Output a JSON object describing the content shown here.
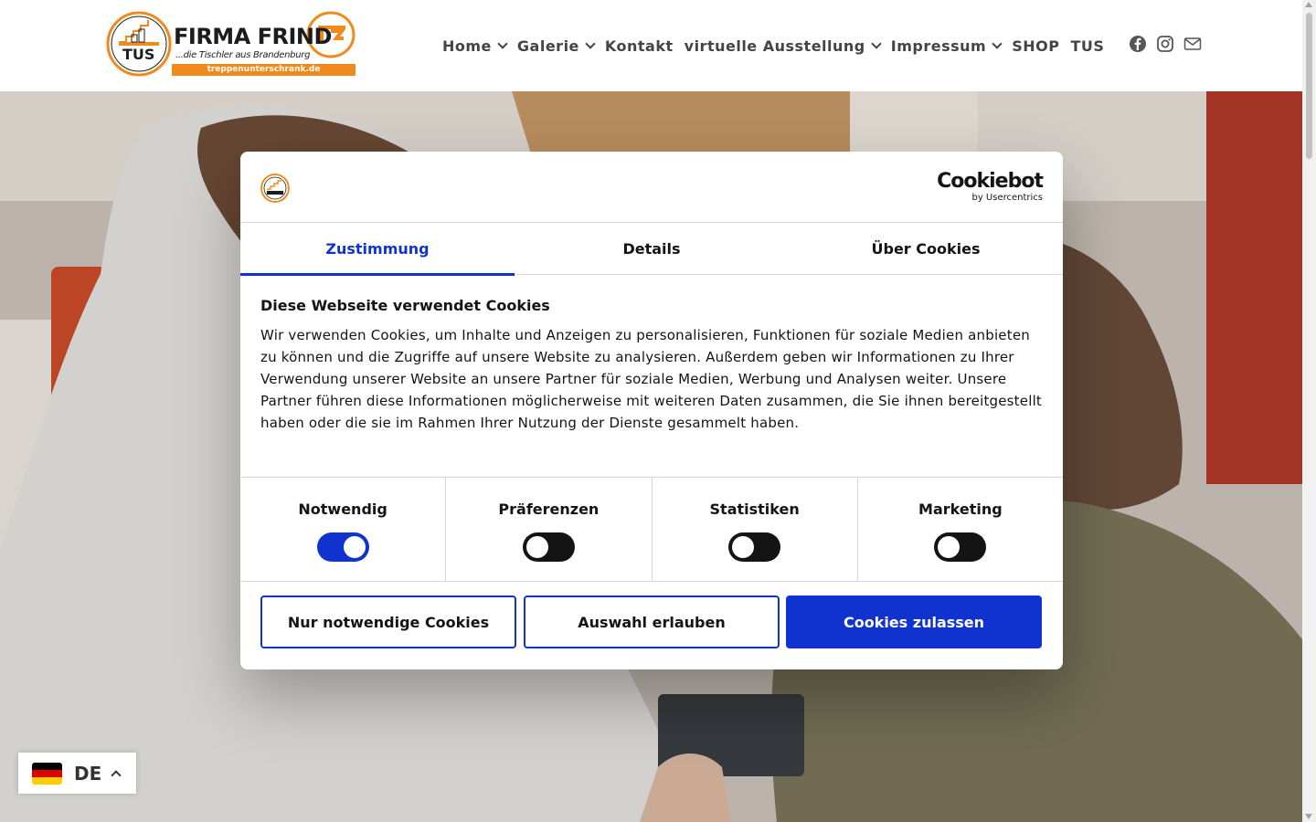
{
  "logo": {
    "title": "FIRMA FRIND",
    "tagline": "...die Tischler aus Brandenburg",
    "url": "treppenunterschrank.de",
    "badge": "TUS",
    "accent": "#f08a1c"
  },
  "nav": {
    "items": [
      {
        "label": "Home",
        "has_dropdown": true
      },
      {
        "label": "Galerie",
        "has_dropdown": true
      },
      {
        "label": "Kontakt",
        "has_dropdown": false
      },
      {
        "label": "virtuelle Ausstellung",
        "has_dropdown": true
      },
      {
        "label": "Impressum",
        "has_dropdown": true
      },
      {
        "label": "SHOP",
        "has_dropdown": false
      },
      {
        "label": "TUS",
        "has_dropdown": false
      }
    ],
    "social_icons": [
      "facebook-icon",
      "instagram-icon",
      "mail-icon"
    ]
  },
  "cookie_dialog": {
    "brand_name": "Cookiebot",
    "brand_sub": "by Usercentrics",
    "tabs": [
      {
        "label": "Zustimmung",
        "active": true
      },
      {
        "label": "Details",
        "active": false
      },
      {
        "label": "Über Cookies",
        "active": false
      }
    ],
    "title": "Diese Webseite verwendet Cookies",
    "text": "Wir verwenden Cookies, um Inhalte und Anzeigen zu personalisieren, Funktionen für soziale Medien anbieten zu können und die Zugriffe auf unsere Website zu analysieren. Außerdem geben wir Informationen zu Ihrer Verwendung unserer Website an unsere Partner für soziale Medien, Werbung und Analysen weiter. Unsere Partner führen diese Informationen möglicherweise mit weiteren Daten zusammen, die Sie ihnen bereitgestellt haben oder die sie im Rahmen Ihrer Nutzung der Dienste gesammelt haben.",
    "categories": [
      {
        "label": "Notwendig",
        "enabled": true
      },
      {
        "label": "Präferenzen",
        "enabled": false
      },
      {
        "label": "Statistiken",
        "enabled": false
      },
      {
        "label": "Marketing",
        "enabled": false
      }
    ],
    "buttons": {
      "necessary_only": "Nur notwendige Cookies",
      "allow_selection": "Auswahl erlauben",
      "allow_all": "Cookies zulassen"
    },
    "accent": "#1032cf"
  },
  "language": {
    "code": "DE",
    "flag_colors": [
      "#000000",
      "#dd0000",
      "#ffce00"
    ]
  }
}
